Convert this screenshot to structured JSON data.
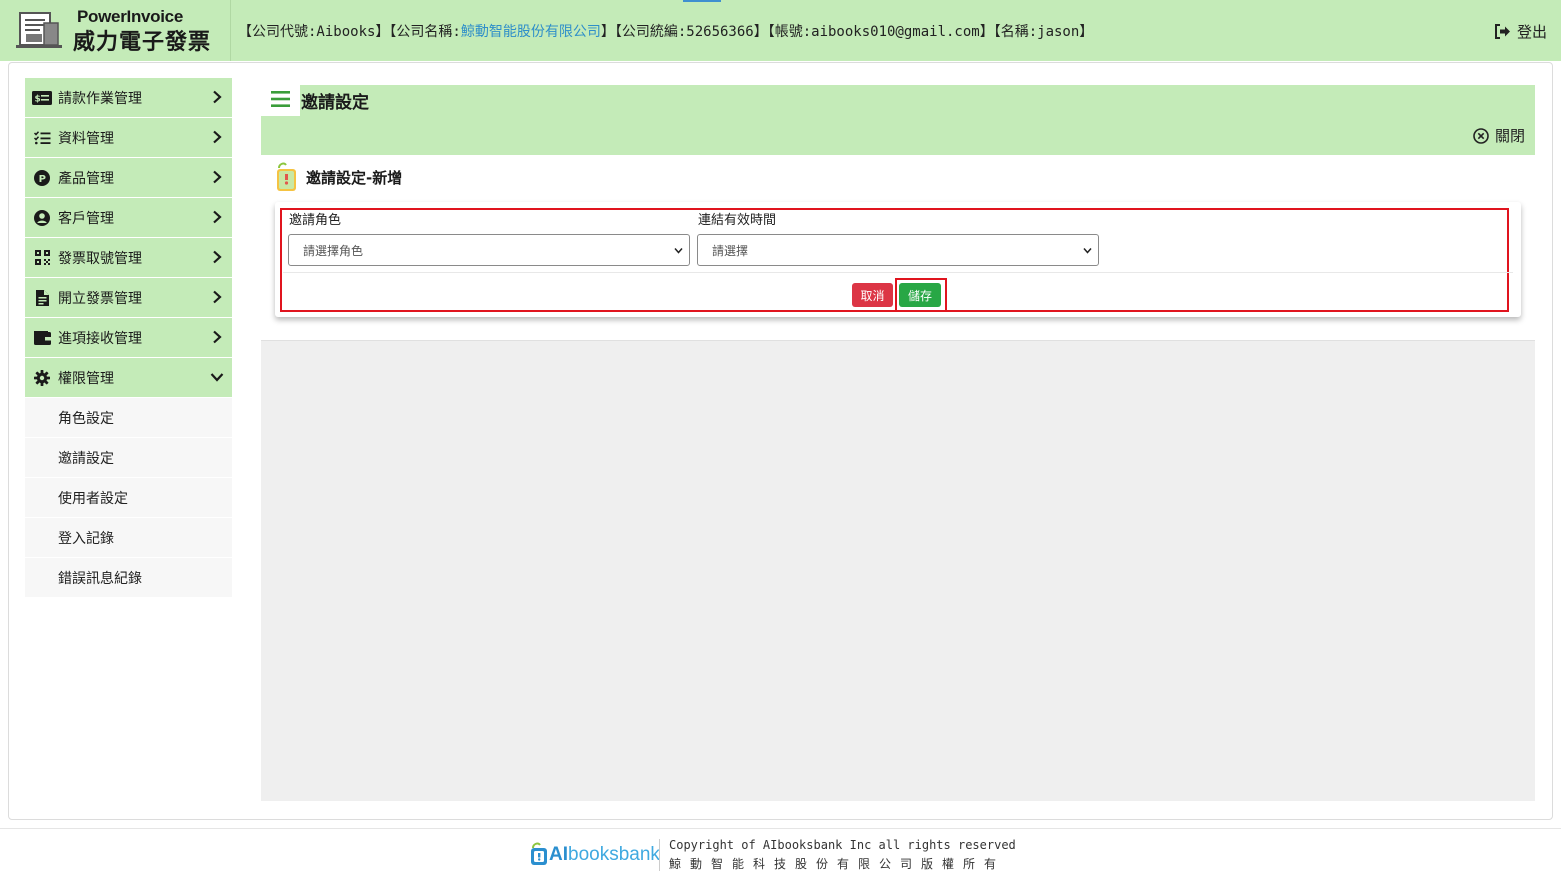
{
  "header": {
    "logo_en": "PowerInvoice",
    "logo_zh": "威力電子發票",
    "info_prefix": "【公司代號:Aibooks】【公司名稱:",
    "company_name": "鯨動智能股份有限公司",
    "info_suffix": "】【公司統編:52656366】【帳號:aibooks010@gmail.com】【名稱:jason】",
    "logout_label": "登出"
  },
  "sidebar": {
    "items": [
      {
        "label": "請款作業管理",
        "icon": "invoice-money-icon"
      },
      {
        "label": "資料管理",
        "icon": "list-check-icon"
      },
      {
        "label": "產品管理",
        "icon": "product-p-icon"
      },
      {
        "label": "客戶管理",
        "icon": "user-circle-icon"
      },
      {
        "label": "發票取號管理",
        "icon": "qrcode-icon"
      },
      {
        "label": "開立發票管理",
        "icon": "document-icon"
      },
      {
        "label": "進項接收管理",
        "icon": "wallet-icon"
      },
      {
        "label": "權限管理",
        "icon": "gear-icon"
      }
    ],
    "sub_items": [
      "角色設定",
      "邀請設定",
      "使用者設定",
      "登入記錄",
      "錯誤訊息紀錄"
    ]
  },
  "content": {
    "title": "邀請設定",
    "close_label": "關閉",
    "panel_title": "邀請設定-新增",
    "form": {
      "role_label": "邀請角色",
      "role_placeholder": "請選擇角色",
      "time_label": "連結有效時間",
      "time_placeholder": "請選擇",
      "cancel_label": "取消",
      "save_label": "儲存"
    }
  },
  "footer": {
    "brand_a": "AI",
    "brand_b": "booksbank",
    "copyright": "Copyright of AIbooksbank Inc all rights reserved",
    "copyright_zh": "鯨動智能科技股份有限公司版權所有"
  },
  "colors": {
    "header_bg": "#c4ebb8",
    "cancel": "#dc3545",
    "save": "#28a745",
    "highlight": "#e0141e",
    "link": "#2f8fc9"
  }
}
